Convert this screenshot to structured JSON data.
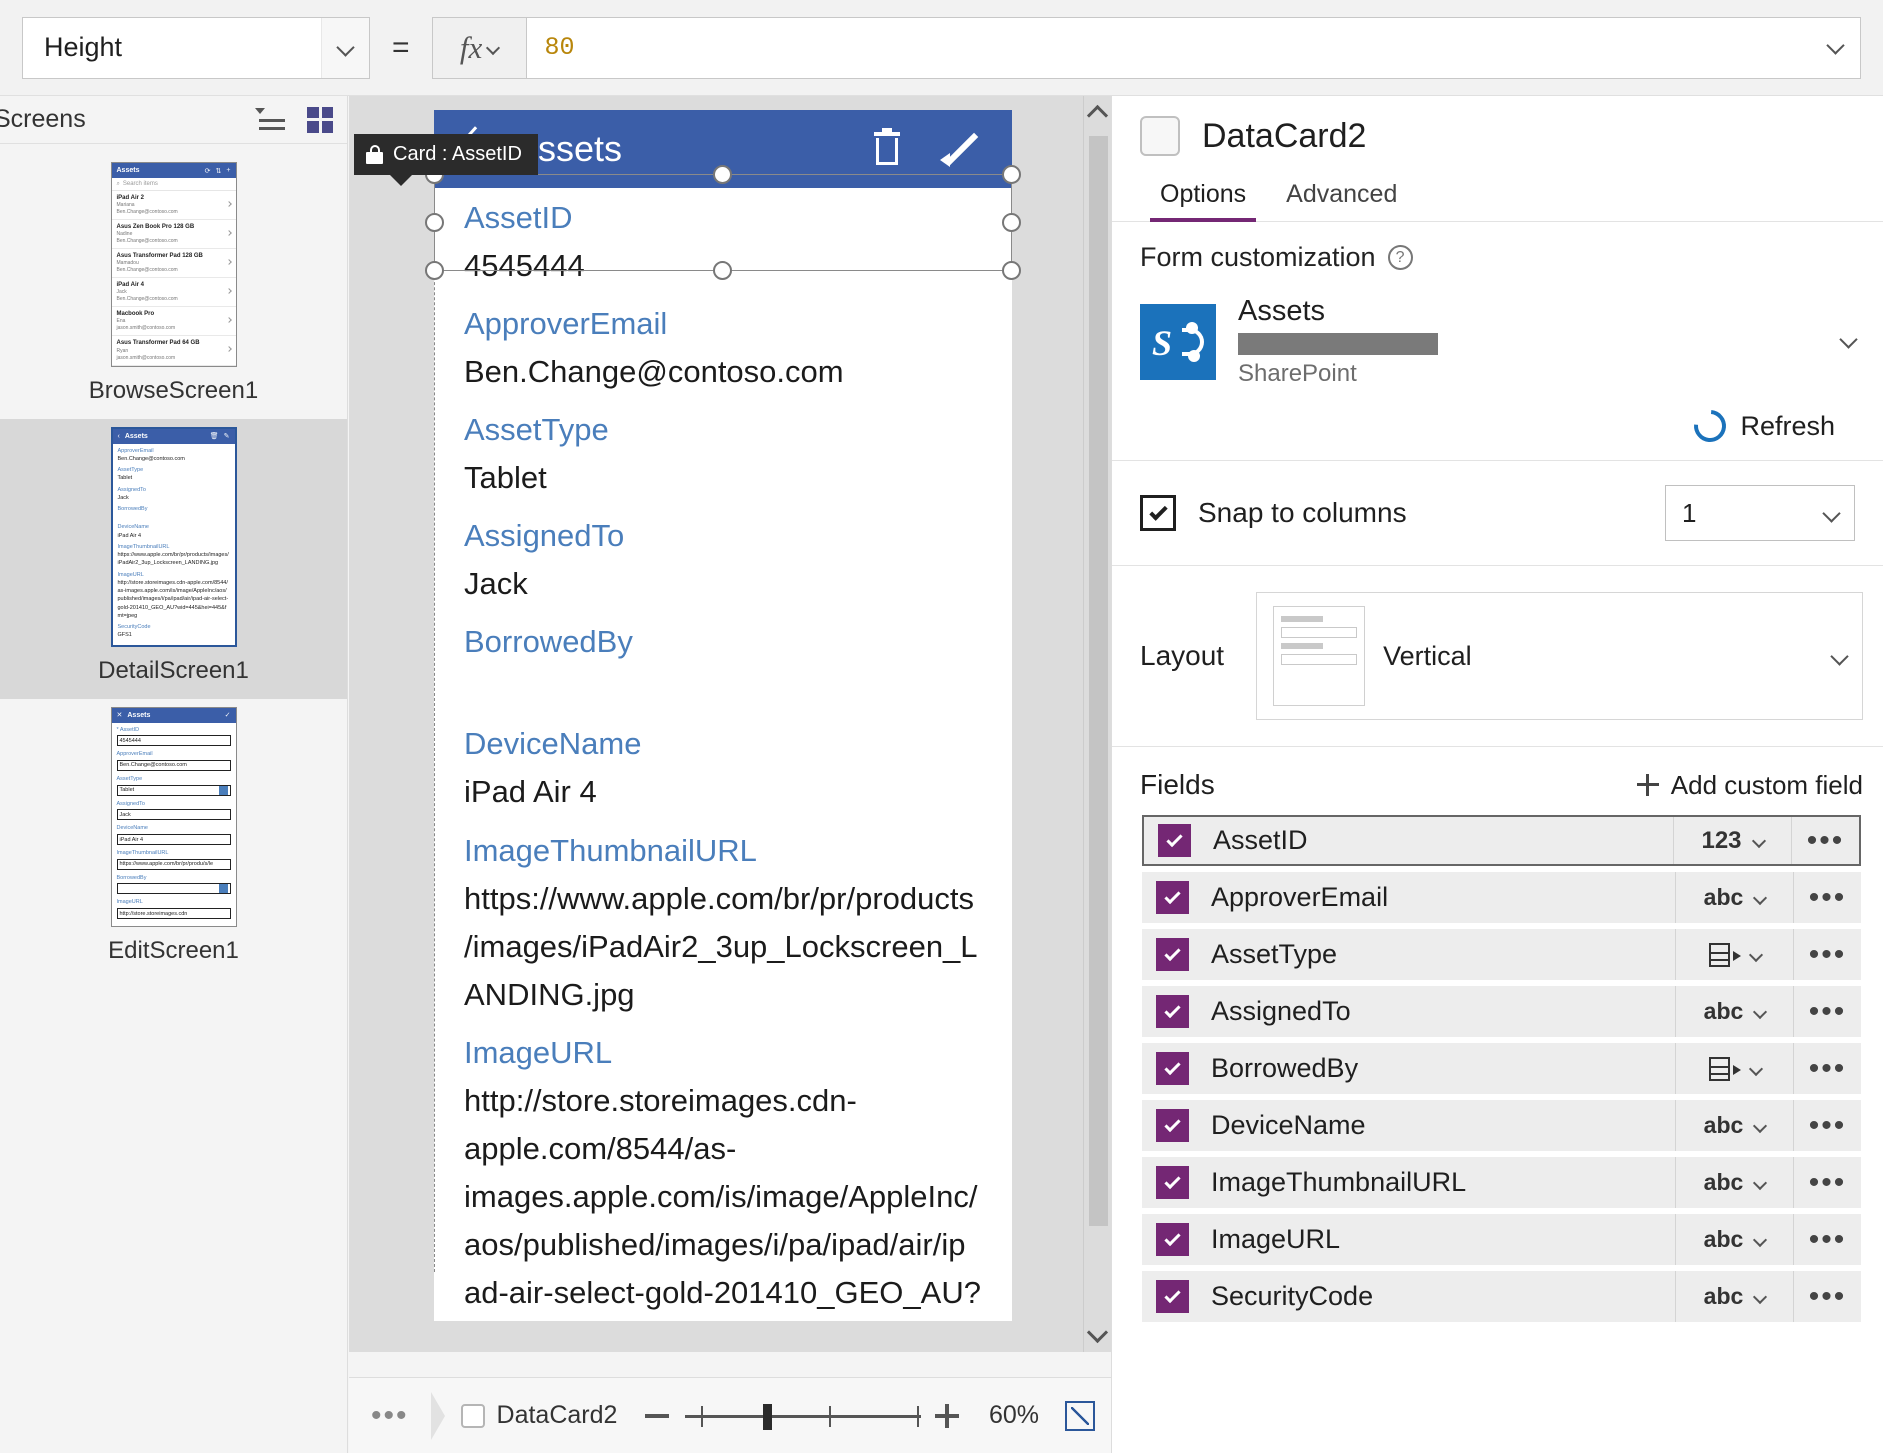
{
  "formula_bar": {
    "property": "Height",
    "equals": "=",
    "fx_label": "fx",
    "value": "80"
  },
  "left_panel": {
    "title": "Screens",
    "icons": {
      "tree": "tree-view-icon",
      "grid": "grid-view-icon"
    },
    "screens": [
      {
        "name": "BrowseScreen1",
        "selected": false,
        "header": "Assets",
        "search_placeholder": "Search items",
        "rows": [
          {
            "title": "iPad Air 2",
            "sub1": "Mariana",
            "sub2": "Ben.Change@contoso.com"
          },
          {
            "title": "Asus Zen Book Pro 128 GB",
            "sub1": "Nadine",
            "sub2": "Ben.Change@contoso.com"
          },
          {
            "title": "Asus Transformer Pad 128 GB",
            "sub1": "Mamadou",
            "sub2": "Ben.Change@contoso.com"
          },
          {
            "title": "iPad Air 4",
            "sub1": "Jack",
            "sub2": "Ben.Change@contoso.com"
          },
          {
            "title": "Macbook Pro",
            "sub1": "Ena",
            "sub2": "jason.smith@contoso.com"
          },
          {
            "title": "Asus Transformer Pad 64 GB",
            "sub1": "Ryan",
            "sub2": "jason.smith@contoso.com"
          }
        ]
      },
      {
        "name": "DetailScreen1",
        "selected": true,
        "header": "Assets",
        "fields": [
          {
            "label": "ApproverEmail",
            "value": "Ben.Change@contoso.com"
          },
          {
            "label": "AssetType",
            "value": "Tablet"
          },
          {
            "label": "AssignedTo",
            "value": "Jack"
          },
          {
            "label": "BorrowedBy",
            "value": ""
          },
          {
            "label": "DeviceName",
            "value": "iPad Air 4"
          },
          {
            "label": "ImageThumbnailURL",
            "value": "https://www.apple.com/br/pr/products/images/iPadAir2_3up_Lockscreen_LANDING.jpg"
          },
          {
            "label": "ImageURL",
            "value": "http://store.storeimages.cdn-apple.com/8544/as-images.apple.com/is/image/AppleInc/aos/published/images/i/pa/ipad/air/ipad-air-select-gold-201410_GEO_AU?wid=445&hei=445&fmt=jpeg"
          },
          {
            "label": "SecurityCode",
            "value": "GFS1"
          }
        ]
      },
      {
        "name": "EditScreen1",
        "selected": false,
        "header": "Assets",
        "fields": [
          {
            "label": "* AssetID",
            "value": "4545444",
            "type": "text"
          },
          {
            "label": "ApproverEmail",
            "value": "Ben.Change@contoso.com",
            "type": "text"
          },
          {
            "label": "AssetType",
            "value": "Tablet",
            "type": "dropdown"
          },
          {
            "label": "AssignedTo",
            "value": "Jack",
            "type": "text"
          },
          {
            "label": "DeviceName",
            "value": "iPad Air 4",
            "type": "text"
          },
          {
            "label": "ImageThumbnailURL",
            "value": "https://www.apple.com/br/pr/produ/s/le",
            "type": "text"
          },
          {
            "label": "BorrowedBy",
            "value": "",
            "type": "dropdown"
          },
          {
            "label": "ImageURL",
            "value": "http://store.storeimages.cdn",
            "type": "text"
          }
        ]
      }
    ]
  },
  "canvas": {
    "tooltip": {
      "text": "Card : AssetID",
      "icon": "lock-icon"
    },
    "screen_title": "Assets",
    "header_icons": [
      {
        "name": "back-arrow-icon"
      },
      {
        "name": "trash-icon"
      },
      {
        "name": "pencil-icon"
      }
    ],
    "fields": [
      {
        "label": "AssetID",
        "value": "4545444"
      },
      {
        "label": "ApproverEmail",
        "value": "Ben.Change@contoso.com"
      },
      {
        "label": "AssetType",
        "value": "Tablet"
      },
      {
        "label": "AssignedTo",
        "value": "Jack"
      },
      {
        "label": "BorrowedBy",
        "value": ""
      },
      {
        "label": "DeviceName",
        "value": "iPad Air 4"
      },
      {
        "label": "ImageThumbnailURL",
        "value": "https://www.apple.com/br/pr/products/images/iPadAir2_3up_Lockscreen_LANDING.jpg"
      },
      {
        "label": "ImageURL",
        "value": "http://store.storeimages.cdn-apple.com/8544/as-images.apple.com/is/image/AppleInc/aos/published/images/i/pa/ipad/air/ipad-air-select-gold-201410_GEO_AU?"
      }
    ]
  },
  "bottom_bar": {
    "breadcrumb_dots": "•••",
    "selected_control": "DataCard2",
    "zoom_percent": "60%",
    "minus": "zoom-out-icon",
    "plus": "zoom-in-icon",
    "fit": "fit-to-screen-icon"
  },
  "right_panel": {
    "title": "DataCard2",
    "tabs": [
      {
        "label": "Options",
        "active": true
      },
      {
        "label": "Advanced",
        "active": false
      }
    ],
    "form_customization": {
      "title": "Form customization",
      "help_icon": "help-icon",
      "data_source": {
        "name": "Assets",
        "url_redacted": true,
        "provider": "SharePoint",
        "icon": "sharepoint-icon"
      },
      "refresh_label": "Refresh",
      "refresh_icon": "refresh-icon"
    },
    "snap_to_columns": {
      "label": "Snap to columns",
      "checked": true,
      "columns": "1"
    },
    "layout": {
      "label": "Layout",
      "value": "Vertical",
      "preview_icon": "vertical-layout-icon"
    },
    "fields_section": {
      "title": "Fields",
      "add_label": "Add custom field",
      "add_icon": "plus-icon",
      "items": [
        {
          "name": "AssetID",
          "checked": true,
          "type": "123",
          "type_kind": "number",
          "selected": true,
          "more": "•••"
        },
        {
          "name": "ApproverEmail",
          "checked": true,
          "type": "abc",
          "type_kind": "text",
          "selected": false,
          "more": "•••"
        },
        {
          "name": "AssetType",
          "checked": true,
          "type": "",
          "type_kind": "table",
          "selected": false,
          "more": "•••"
        },
        {
          "name": "AssignedTo",
          "checked": true,
          "type": "abc",
          "type_kind": "text",
          "selected": false,
          "more": "•••"
        },
        {
          "name": "BorrowedBy",
          "checked": true,
          "type": "",
          "type_kind": "table",
          "selected": false,
          "more": "•••"
        },
        {
          "name": "DeviceName",
          "checked": true,
          "type": "abc",
          "type_kind": "text",
          "selected": false,
          "more": "•••"
        },
        {
          "name": "ImageThumbnailURL",
          "checked": true,
          "type": "abc",
          "type_kind": "text",
          "selected": false,
          "more": "•••"
        },
        {
          "name": "ImageURL",
          "checked": true,
          "type": "abc",
          "type_kind": "text",
          "selected": false,
          "more": "•••"
        },
        {
          "name": "SecurityCode",
          "checked": true,
          "type": "abc",
          "type_kind": "text",
          "selected": false,
          "more": "•••"
        }
      ]
    }
  },
  "colors": {
    "app_header_blue": "#3b5ea8",
    "accent_purple": "#742774",
    "label_blue": "#4a7ebb",
    "formula_value": "#b8860b",
    "sharepoint_blue": "#1b72bb"
  }
}
